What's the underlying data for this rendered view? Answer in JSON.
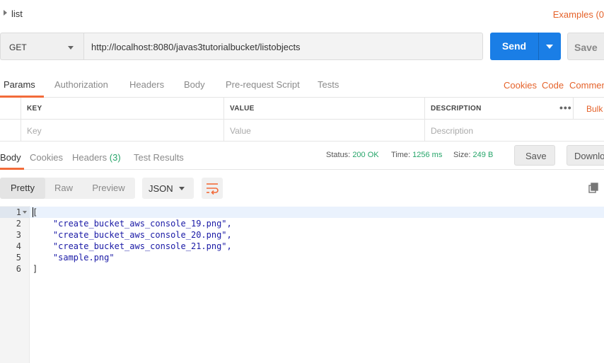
{
  "request": {
    "name": "list",
    "examples_label": "Examples (0"
  },
  "url_bar": {
    "method": "GET",
    "url": "http://localhost:8080/javas3tutorialbucket/listobjects",
    "send_label": "Send",
    "save_label": "Save"
  },
  "request_tabs": {
    "items": [
      "Params",
      "Authorization",
      "Headers",
      "Body",
      "Pre-request Script",
      "Tests"
    ],
    "active": "Params",
    "right_links": [
      "Cookies",
      "Code",
      "Commen"
    ]
  },
  "params_table": {
    "headers": [
      "KEY",
      "VALUE",
      "DESCRIPTION"
    ],
    "placeholders": [
      "Key",
      "Value",
      "Description"
    ],
    "more_label": "•••",
    "bulk_edit_label": "Bulk"
  },
  "response_tabs": {
    "items": [
      "Body",
      "Cookies",
      "Headers",
      "Test Results"
    ],
    "headers_count": "(3)",
    "active": "Body",
    "status_label": "Status:",
    "status_value": "200 OK",
    "time_label": "Time:",
    "time_value": "1256 ms",
    "size_label": "Size:",
    "size_value": "249 B",
    "save_label": "Save",
    "download_label": "Downlo"
  },
  "body_toolbar": {
    "views": [
      "Pretty",
      "Raw",
      "Preview"
    ],
    "active_view": "Pretty",
    "format": "JSON",
    "wrap_icon": "wrap-lines-icon",
    "copy_icon": "copy-icon"
  },
  "editor": {
    "lines": [
      {
        "num": "1",
        "text": "[",
        "is_string": false
      },
      {
        "num": "2",
        "text": "    \"create_bucket_aws_console_19.png\",",
        "is_string": true
      },
      {
        "num": "3",
        "text": "    \"create_bucket_aws_console_20.png\",",
        "is_string": true
      },
      {
        "num": "4",
        "text": "    \"create_bucket_aws_console_21.png\",",
        "is_string": true
      },
      {
        "num": "5",
        "text": "    \"sample.png\"",
        "is_string": true
      },
      {
        "num": "6",
        "text": "]",
        "is_string": false
      }
    ]
  },
  "colors": {
    "accent": "#f26b3a",
    "link": "#e5622a",
    "send": "#1a7ee6",
    "success": "#26a56a",
    "string": "#1a1aa6"
  }
}
